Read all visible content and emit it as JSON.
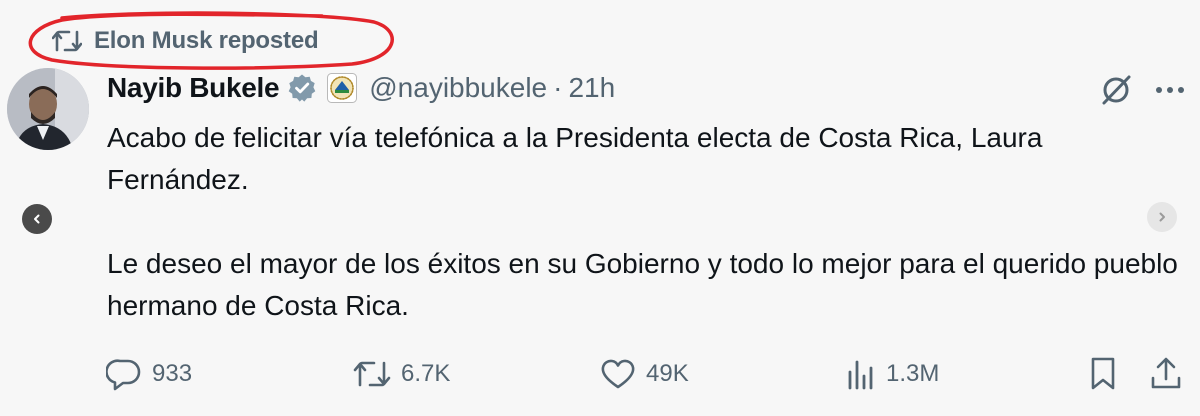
{
  "repost": {
    "label": "Elon Musk reposted",
    "icon": "repost-icon",
    "highlight_color": "#e2252b"
  },
  "author": {
    "display_name": "Nayib Bukele",
    "verified_icon": "verified-badge-icon",
    "affiliate_icon": "el-salvador-seal-icon",
    "handle": "@nayibbukele",
    "separator": "·",
    "time": "21h"
  },
  "tweet": {
    "paragraphs": [
      "Acabo de felicitar vía telefónica a la Presidenta electa de Costa Rica, Laura Fernández.",
      "Le deseo el mayor de los éxitos en su Gobierno y todo lo mejor para el querido pueblo hermano de Costa Rica."
    ]
  },
  "actions": {
    "replies": "933",
    "reposts": "6.7K",
    "likes": "49K",
    "views": "1.3M"
  },
  "colors": {
    "text_primary": "#0f1419",
    "text_secondary": "#536471",
    "verified": "#829aab",
    "background": "#f7f7f7"
  }
}
